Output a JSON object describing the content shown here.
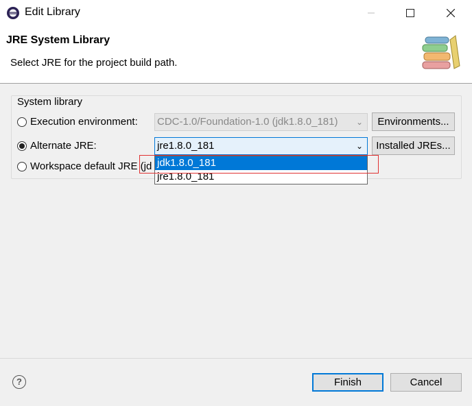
{
  "window": {
    "title": "Edit Library"
  },
  "header": {
    "title": "JRE System Library",
    "description": "Select JRE for the project build path."
  },
  "group": {
    "label": "System library",
    "options": {
      "execution_environment": {
        "label": "Execution environment:",
        "selected": false,
        "value": "CDC-1.0/Foundation-1.0 (jdk1.8.0_181)",
        "button": "Environments..."
      },
      "alternate_jre": {
        "label": "Alternate JRE:",
        "selected": true,
        "value": "jre1.8.0_181",
        "button": "Installed JREs..."
      },
      "workspace_default": {
        "label": "Workspace default JRE (jd",
        "selected": false
      }
    }
  },
  "dropdown": {
    "items": [
      "jdk1.8.0_181",
      "jre1.8.0_181"
    ],
    "highlighted_index": 0
  },
  "footer": {
    "finish": "Finish",
    "cancel": "Cancel",
    "help_symbol": "?"
  },
  "colors": {
    "accent": "#0078d7",
    "highlight_border": "#e03030"
  },
  "icons": [
    "eclipse-app-icon",
    "minimize-icon",
    "maximize-icon",
    "close-icon",
    "books-icon",
    "chevron-down-icon",
    "help-icon"
  ]
}
